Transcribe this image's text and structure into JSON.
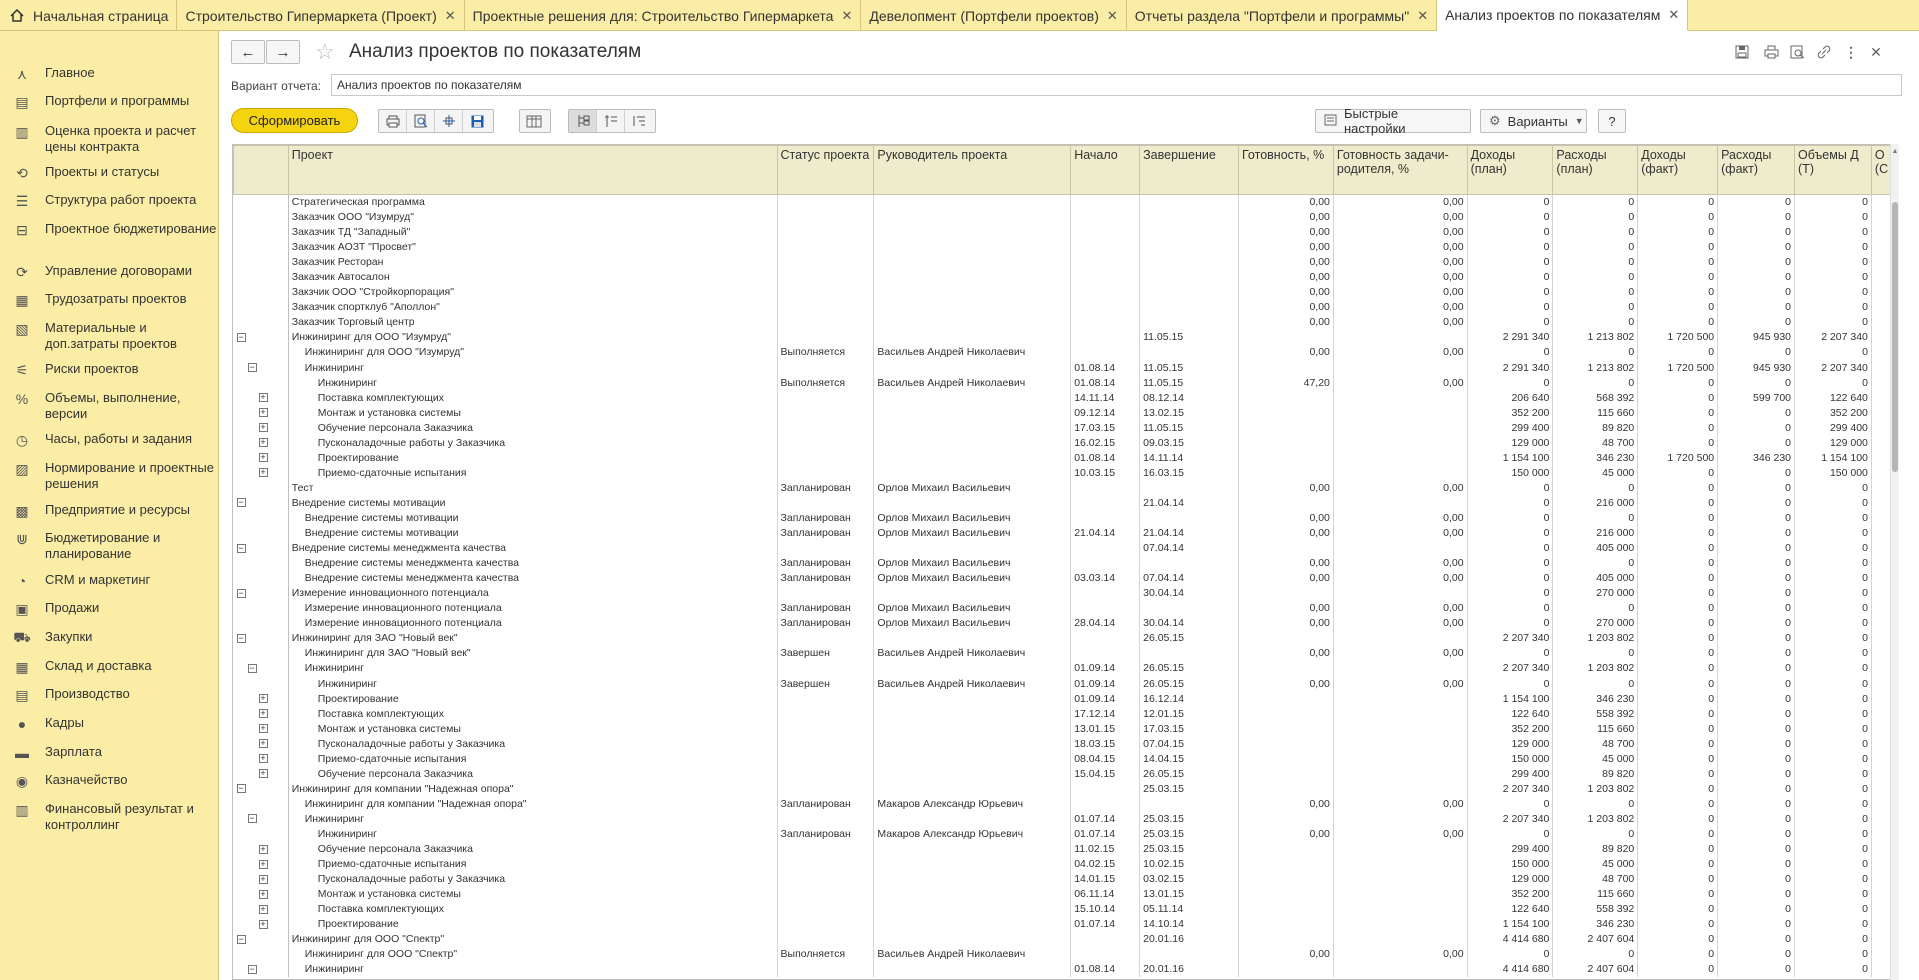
{
  "tabs": [
    {
      "label": "Начальная страница",
      "home": true
    },
    {
      "label": "Строительство Гипермаркета (Проект)",
      "close": "✕"
    },
    {
      "label": "Проектные решения для: Строительство Гипермаркета",
      "close": "✕"
    },
    {
      "label": "Девелопмент (Портфели проектов)",
      "close": "✕"
    },
    {
      "label": "Отчеты раздела \"Портфели и программы\"",
      "close": "✕"
    },
    {
      "label": "Анализ проектов по показателям",
      "close": "✕",
      "active": true
    }
  ],
  "sidebar": [
    {
      "label": "Главное",
      "icon": "menu-icon"
    },
    {
      "label": "Портфели и программы",
      "icon": "portfolio-icon"
    },
    {
      "label": "Оценка проекта и расчет цены контракта",
      "icon": "estimate-icon"
    },
    {
      "label": "Проекты и статусы",
      "icon": "projects-icon"
    },
    {
      "label": "Структура работ проекта",
      "icon": "structure-icon"
    },
    {
      "label": "Проектное бюджетирование",
      "icon": "budget-icon"
    },
    {
      "label": "Управление договорами",
      "icon": "contract-icon"
    },
    {
      "label": "Трудозатраты проектов",
      "icon": "labor-icon"
    },
    {
      "label": "Материальные и доп.затраты проектов",
      "icon": "materials-icon"
    },
    {
      "label": "Риски проектов",
      "icon": "risk-icon"
    },
    {
      "label": "Объемы, выполнение, версии",
      "icon": "volume-icon"
    },
    {
      "label": "Часы, работы и задания",
      "icon": "hours-icon"
    },
    {
      "label": "Нормирование и проектные решения",
      "icon": "norm-icon"
    },
    {
      "label": "Предприятие и ресурсы",
      "icon": "enterprise-icon"
    },
    {
      "label": "Бюджетирование и планирование",
      "icon": "planning-icon"
    },
    {
      "label": "CRM и маркетинг",
      "icon": "crm-icon"
    },
    {
      "label": "Продажи",
      "icon": "sales-icon"
    },
    {
      "label": "Закупки",
      "icon": "purchase-icon"
    },
    {
      "label": "Склад и доставка",
      "icon": "warehouse-icon"
    },
    {
      "label": "Производство",
      "icon": "production-icon"
    },
    {
      "label": "Кадры",
      "icon": "staff-icon"
    },
    {
      "label": "Зарплата",
      "icon": "salary-icon"
    },
    {
      "label": "Казначейство",
      "icon": "treasury-icon"
    },
    {
      "label": "Финансовый результат и контроллинг",
      "icon": "finance-icon"
    }
  ],
  "header": {
    "title": "Анализ проектов по показателям",
    "back": "←",
    "forward": "→",
    "star": "☆"
  },
  "variant": {
    "label": "Вариант отчета:",
    "value": "Анализ проектов по показателям"
  },
  "toolbar": {
    "run_label": "Сформировать",
    "quick_settings_label": "Быстрые настройки",
    "variants_label": "Варианты",
    "help_label": "?"
  },
  "columns": [
    "Проект",
    "Статус проекта",
    "Руководитель проекта",
    "Начало",
    "Завершение",
    "Готовность, %",
    "Готовность задачи-родителя, %",
    "Доходы (план)",
    "Расходы (план)",
    "Доходы (факт)",
    "Расходы (факт)",
    "Объемы Д (Т)",
    "О (С"
  ],
  "rows": [
    {
      "lvl": 0,
      "t": "",
      "name": "Стратегическая программа",
      "st": "",
      "mgr": "",
      "s": "",
      "e": "",
      "r": "0,00",
      "rp": "0,00",
      "di": "0",
      "rpl": "0",
      "df": "0",
      "rf": "0",
      "v": "0"
    },
    {
      "lvl": 0,
      "t": "",
      "name": "Заказчик ООО \"Изумруд\"",
      "st": "",
      "mgr": "",
      "s": "",
      "e": "",
      "r": "0,00",
      "rp": "0,00",
      "di": "0",
      "rpl": "0",
      "df": "0",
      "rf": "0",
      "v": "0"
    },
    {
      "lvl": 0,
      "t": "",
      "name": "Заказчик ТД \"Западный\"",
      "st": "",
      "mgr": "",
      "s": "",
      "e": "",
      "r": "0,00",
      "rp": "0,00",
      "di": "0",
      "rpl": "0",
      "df": "0",
      "rf": "0",
      "v": "0"
    },
    {
      "lvl": 0,
      "t": "",
      "name": "Заказчик АОЗТ \"Просвет\"",
      "st": "",
      "mgr": "",
      "s": "",
      "e": "",
      "r": "0,00",
      "rp": "0,00",
      "di": "0",
      "rpl": "0",
      "df": "0",
      "rf": "0",
      "v": "0"
    },
    {
      "lvl": 0,
      "t": "",
      "name": "Заказчик Ресторан",
      "st": "",
      "mgr": "",
      "s": "",
      "e": "",
      "r": "0,00",
      "rp": "0,00",
      "di": "0",
      "rpl": "0",
      "df": "0",
      "rf": "0",
      "v": "0"
    },
    {
      "lvl": 0,
      "t": "",
      "name": "Заказчик Автосалон",
      "st": "",
      "mgr": "",
      "s": "",
      "e": "",
      "r": "0,00",
      "rp": "0,00",
      "di": "0",
      "rpl": "0",
      "df": "0",
      "rf": "0",
      "v": "0"
    },
    {
      "lvl": 0,
      "t": "",
      "name": "Закзчик ООО \"Стройкорпорация\"",
      "st": "",
      "mgr": "",
      "s": "",
      "e": "",
      "r": "0,00",
      "rp": "0,00",
      "di": "0",
      "rpl": "0",
      "df": "0",
      "rf": "0",
      "v": "0"
    },
    {
      "lvl": 0,
      "t": "",
      "name": "Заказчик спортклуб \"Аполлон\"",
      "st": "",
      "mgr": "",
      "s": "",
      "e": "",
      "r": "0,00",
      "rp": "0,00",
      "di": "0",
      "rpl": "0",
      "df": "0",
      "rf": "0",
      "v": "0"
    },
    {
      "lvl": 0,
      "t": "",
      "name": "Заказчик Торговый центр",
      "st": "",
      "mgr": "",
      "s": "",
      "e": "",
      "r": "0,00",
      "rp": "0,00",
      "di": "0",
      "rpl": "0",
      "df": "0",
      "rf": "0",
      "v": "0"
    },
    {
      "lvl": 0,
      "t": "−",
      "name": "Инжиниринг для ООО \"Изумруд\"",
      "st": "",
      "mgr": "",
      "s": "",
      "e": "11.05.15",
      "r": "",
      "rp": "",
      "di": "2 291 340",
      "rpl": "1 213 802",
      "df": "1 720 500",
      "rf": "945 930",
      "v": "2 207 340"
    },
    {
      "lvl": 1,
      "t": "",
      "name": "Инжиниринг для ООО \"Изумруд\"",
      "st": "Выполняется",
      "mgr": "Васильев Андрей Николаевич",
      "s": "",
      "e": "",
      "r": "0,00",
      "rp": "0,00",
      "di": "0",
      "rpl": "0",
      "df": "0",
      "rf": "0",
      "v": "0"
    },
    {
      "lvl": 1,
      "t": "−",
      "name": "Инжиниринг",
      "st": "",
      "mgr": "",
      "s": "01.08.14",
      "e": "11.05.15",
      "r": "",
      "rp": "",
      "di": "2 291 340",
      "rpl": "1 213 802",
      "df": "1 720 500",
      "rf": "945 930",
      "v": "2 207 340"
    },
    {
      "lvl": 2,
      "t": "",
      "name": "Инжиниринг",
      "st": "Выполняется",
      "mgr": "Васильев Андрей Николаевич",
      "s": "01.08.14",
      "e": "11.05.15",
      "r": "47,20",
      "rp": "0,00",
      "di": "0",
      "rpl": "0",
      "df": "0",
      "rf": "0",
      "v": "0"
    },
    {
      "lvl": 2,
      "t": "+",
      "name": "Поставка комплектующих",
      "st": "",
      "mgr": "",
      "s": "14.11.14",
      "e": "08.12.14",
      "r": "",
      "rp": "",
      "di": "206 640",
      "rpl": "568 392",
      "df": "0",
      "rf": "599 700",
      "v": "122 640"
    },
    {
      "lvl": 2,
      "t": "+",
      "name": "Монтаж и установка системы",
      "st": "",
      "mgr": "",
      "s": "09.12.14",
      "e": "13.02.15",
      "r": "",
      "rp": "",
      "di": "352 200",
      "rpl": "115 660",
      "df": "0",
      "rf": "0",
      "v": "352 200"
    },
    {
      "lvl": 2,
      "t": "+",
      "name": "Обучение персонала Заказчика",
      "st": "",
      "mgr": "",
      "s": "17.03.15",
      "e": "11.05.15",
      "r": "",
      "rp": "",
      "di": "299 400",
      "rpl": "89 820",
      "df": "0",
      "rf": "0",
      "v": "299 400"
    },
    {
      "lvl": 2,
      "t": "+",
      "name": "Пусконаладочные работы у Заказчика",
      "st": "",
      "mgr": "",
      "s": "16.02.15",
      "e": "09.03.15",
      "r": "",
      "rp": "",
      "di": "129 000",
      "rpl": "48 700",
      "df": "0",
      "rf": "0",
      "v": "129 000"
    },
    {
      "lvl": 2,
      "t": "+",
      "name": "Проектирование",
      "st": "",
      "mgr": "",
      "s": "01.08.14",
      "e": "14.11.14",
      "r": "",
      "rp": "",
      "di": "1 154 100",
      "rpl": "346 230",
      "df": "1 720 500",
      "rf": "346 230",
      "v": "1 154 100"
    },
    {
      "lvl": 2,
      "t": "+",
      "name": "Приемо-сдаточные испытания",
      "st": "",
      "mgr": "",
      "s": "10.03.15",
      "e": "16.03.15",
      "r": "",
      "rp": "",
      "di": "150 000",
      "rpl": "45 000",
      "df": "0",
      "rf": "0",
      "v": "150 000"
    },
    {
      "lvl": 0,
      "t": "",
      "name": "Тест",
      "st": "Запланирован",
      "mgr": "Орлов Михаил Васильевич",
      "s": "",
      "e": "",
      "r": "0,00",
      "rp": "0,00",
      "di": "0",
      "rpl": "0",
      "df": "0",
      "rf": "0",
      "v": "0"
    },
    {
      "lvl": 0,
      "t": "−",
      "name": "Внедрение системы мотивации",
      "st": "",
      "mgr": "",
      "s": "",
      "e": "21.04.14",
      "r": "",
      "rp": "",
      "di": "0",
      "rpl": "216 000",
      "df": "0",
      "rf": "0",
      "v": "0"
    },
    {
      "lvl": 1,
      "t": "",
      "name": "Внедрение системы мотивации",
      "st": "Запланирован",
      "mgr": "Орлов Михаил Васильевич",
      "s": "",
      "e": "",
      "r": "0,00",
      "rp": "0,00",
      "di": "0",
      "rpl": "0",
      "df": "0",
      "rf": "0",
      "v": "0"
    },
    {
      "lvl": 1,
      "t": "",
      "name": "Внедрение системы мотивации",
      "st": "Запланирован",
      "mgr": "Орлов Михаил Васильевич",
      "s": "21.04.14",
      "e": "21.04.14",
      "r": "0,00",
      "rp": "0,00",
      "di": "0",
      "rpl": "216 000",
      "df": "0",
      "rf": "0",
      "v": "0"
    },
    {
      "lvl": 0,
      "t": "−",
      "name": "Внедрение системы менеджмента качества",
      "st": "",
      "mgr": "",
      "s": "",
      "e": "07.04.14",
      "r": "",
      "rp": "",
      "di": "0",
      "rpl": "405 000",
      "df": "0",
      "rf": "0",
      "v": "0"
    },
    {
      "lvl": 1,
      "t": "",
      "name": "Внедрение системы менеджмента качества",
      "st": "Запланирован",
      "mgr": "Орлов Михаил Васильевич",
      "s": "",
      "e": "",
      "r": "0,00",
      "rp": "0,00",
      "di": "0",
      "rpl": "0",
      "df": "0",
      "rf": "0",
      "v": "0"
    },
    {
      "lvl": 1,
      "t": "",
      "name": "Внедрение системы менеджмента качества",
      "st": "Запланирован",
      "mgr": "Орлов Михаил Васильевич",
      "s": "03.03.14",
      "e": "07.04.14",
      "r": "0,00",
      "rp": "0,00",
      "di": "0",
      "rpl": "405 000",
      "df": "0",
      "rf": "0",
      "v": "0"
    },
    {
      "lvl": 0,
      "t": "−",
      "name": "Измерение инновационного потенциала",
      "st": "",
      "mgr": "",
      "s": "",
      "e": "30.04.14",
      "r": "",
      "rp": "",
      "di": "0",
      "rpl": "270 000",
      "df": "0",
      "rf": "0",
      "v": "0"
    },
    {
      "lvl": 1,
      "t": "",
      "name": "Измерение инновационного потенциала",
      "st": "Запланирован",
      "mgr": "Орлов Михаил Васильевич",
      "s": "",
      "e": "",
      "r": "0,00",
      "rp": "0,00",
      "di": "0",
      "rpl": "0",
      "df": "0",
      "rf": "0",
      "v": "0"
    },
    {
      "lvl": 1,
      "t": "",
      "name": "Измерение инновационного потенциала",
      "st": "Запланирован",
      "mgr": "Орлов Михаил Васильевич",
      "s": "28.04.14",
      "e": "30.04.14",
      "r": "0,00",
      "rp": "0,00",
      "di": "0",
      "rpl": "270 000",
      "df": "0",
      "rf": "0",
      "v": "0"
    },
    {
      "lvl": 0,
      "t": "−",
      "name": "Инжиниринг для ЗАО \"Новый век\"",
      "st": "",
      "mgr": "",
      "s": "",
      "e": "26.05.15",
      "r": "",
      "rp": "",
      "di": "2 207 340",
      "rpl": "1 203 802",
      "df": "0",
      "rf": "0",
      "v": "0"
    },
    {
      "lvl": 1,
      "t": "",
      "name": "Инжиниринг для ЗАО \"Новый век\"",
      "st": "Завершен",
      "mgr": "Васильев Андрей Николаевич",
      "s": "",
      "e": "",
      "r": "0,00",
      "rp": "0,00",
      "di": "0",
      "rpl": "0",
      "df": "0",
      "rf": "0",
      "v": "0"
    },
    {
      "lvl": 1,
      "t": "−",
      "name": "Инжиниринг",
      "st": "",
      "mgr": "",
      "s": "01.09.14",
      "e": "26.05.15",
      "r": "",
      "rp": "",
      "di": "2 207 340",
      "rpl": "1 203 802",
      "df": "0",
      "rf": "0",
      "v": "0"
    },
    {
      "lvl": 2,
      "t": "",
      "name": "Инжиниринг",
      "st": "Завершен",
      "mgr": "Васильев Андрей Николаевич",
      "s": "01.09.14",
      "e": "26.05.15",
      "r": "0,00",
      "rp": "0,00",
      "di": "0",
      "rpl": "0",
      "df": "0",
      "rf": "0",
      "v": "0"
    },
    {
      "lvl": 2,
      "t": "+",
      "name": "Проектирование",
      "st": "",
      "mgr": "",
      "s": "01.09.14",
      "e": "16.12.14",
      "r": "",
      "rp": "",
      "di": "1 154 100",
      "rpl": "346 230",
      "df": "0",
      "rf": "0",
      "v": "0"
    },
    {
      "lvl": 2,
      "t": "+",
      "name": "Поставка комплектующих",
      "st": "",
      "mgr": "",
      "s": "17.12.14",
      "e": "12.01.15",
      "r": "",
      "rp": "",
      "di": "122 640",
      "rpl": "558 392",
      "df": "0",
      "rf": "0",
      "v": "0"
    },
    {
      "lvl": 2,
      "t": "+",
      "name": "Монтаж и установка системы",
      "st": "",
      "mgr": "",
      "s": "13.01.15",
      "e": "17.03.15",
      "r": "",
      "rp": "",
      "di": "352 200",
      "rpl": "115 660",
      "df": "0",
      "rf": "0",
      "v": "0"
    },
    {
      "lvl": 2,
      "t": "+",
      "name": "Пусконаладочные работы у Заказчика",
      "st": "",
      "mgr": "",
      "s": "18.03.15",
      "e": "07.04.15",
      "r": "",
      "rp": "",
      "di": "129 000",
      "rpl": "48 700",
      "df": "0",
      "rf": "0",
      "v": "0"
    },
    {
      "lvl": 2,
      "t": "+",
      "name": "Приемо-сдаточные испытания",
      "st": "",
      "mgr": "",
      "s": "08.04.15",
      "e": "14.04.15",
      "r": "",
      "rp": "",
      "di": "150 000",
      "rpl": "45 000",
      "df": "0",
      "rf": "0",
      "v": "0"
    },
    {
      "lvl": 2,
      "t": "+",
      "name": "Обучение персонала Заказчика",
      "st": "",
      "mgr": "",
      "s": "15.04.15",
      "e": "26.05.15",
      "r": "",
      "rp": "",
      "di": "299 400",
      "rpl": "89 820",
      "df": "0",
      "rf": "0",
      "v": "0"
    },
    {
      "lvl": 0,
      "t": "−",
      "name": "Инжиниринг для компании \"Надежная опора\"",
      "st": "",
      "mgr": "",
      "s": "",
      "e": "25.03.15",
      "r": "",
      "rp": "",
      "di": "2 207 340",
      "rpl": "1 203 802",
      "df": "0",
      "rf": "0",
      "v": "0"
    },
    {
      "lvl": 1,
      "t": "",
      "name": "Инжиниринг для компании \"Надежная опора\"",
      "st": "Запланирован",
      "mgr": "Макаров Александр Юрьевич",
      "s": "",
      "e": "",
      "r": "0,00",
      "rp": "0,00",
      "di": "0",
      "rpl": "0",
      "df": "0",
      "rf": "0",
      "v": "0"
    },
    {
      "lvl": 1,
      "t": "−",
      "name": "Инжиниринг",
      "st": "",
      "mgr": "",
      "s": "01.07.14",
      "e": "25.03.15",
      "r": "",
      "rp": "",
      "di": "2 207 340",
      "rpl": "1 203 802",
      "df": "0",
      "rf": "0",
      "v": "0"
    },
    {
      "lvl": 2,
      "t": "",
      "name": "Инжиниринг",
      "st": "Запланирован",
      "mgr": "Макаров Александр Юрьевич",
      "s": "01.07.14",
      "e": "25.03.15",
      "r": "0,00",
      "rp": "0,00",
      "di": "0",
      "rpl": "0",
      "df": "0",
      "rf": "0",
      "v": "0"
    },
    {
      "lvl": 2,
      "t": "+",
      "name": "Обучение персонала Заказчика",
      "st": "",
      "mgr": "",
      "s": "11.02.15",
      "e": "25.03.15",
      "r": "",
      "rp": "",
      "di": "299 400",
      "rpl": "89 820",
      "df": "0",
      "rf": "0",
      "v": "0"
    },
    {
      "lvl": 2,
      "t": "+",
      "name": "Приемо-сдаточные испытания",
      "st": "",
      "mgr": "",
      "s": "04.02.15",
      "e": "10.02.15",
      "r": "",
      "rp": "",
      "di": "150 000",
      "rpl": "45 000",
      "df": "0",
      "rf": "0",
      "v": "0"
    },
    {
      "lvl": 2,
      "t": "+",
      "name": "Пусконаладочные работы у Заказчика",
      "st": "",
      "mgr": "",
      "s": "14.01.15",
      "e": "03.02.15",
      "r": "",
      "rp": "",
      "di": "129 000",
      "rpl": "48 700",
      "df": "0",
      "rf": "0",
      "v": "0"
    },
    {
      "lvl": 2,
      "t": "+",
      "name": "Монтаж и установка системы",
      "st": "",
      "mgr": "",
      "s": "06.11.14",
      "e": "13.01.15",
      "r": "",
      "rp": "",
      "di": "352 200",
      "rpl": "115 660",
      "df": "0",
      "rf": "0",
      "v": "0"
    },
    {
      "lvl": 2,
      "t": "+",
      "name": "Поставка комплектующих",
      "st": "",
      "mgr": "",
      "s": "15.10.14",
      "e": "05.11.14",
      "r": "",
      "rp": "",
      "di": "122 640",
      "rpl": "558 392",
      "df": "0",
      "rf": "0",
      "v": "0"
    },
    {
      "lvl": 2,
      "t": "+",
      "name": "Проектирование",
      "st": "",
      "mgr": "",
      "s": "01.07.14",
      "e": "14.10.14",
      "r": "",
      "rp": "",
      "di": "1 154 100",
      "rpl": "346 230",
      "df": "0",
      "rf": "0",
      "v": "0"
    },
    {
      "lvl": 0,
      "t": "−",
      "name": "Инжиниринг для ООО \"Спектр\"",
      "st": "",
      "mgr": "",
      "s": "",
      "e": "20.01.16",
      "r": "",
      "rp": "",
      "di": "4 414 680",
      "rpl": "2 407 604",
      "df": "0",
      "rf": "0",
      "v": "0"
    },
    {
      "lvl": 1,
      "t": "",
      "name": "Инжиниринг для ООО \"Спектр\"",
      "st": "Выполняется",
      "mgr": "Васильев Андрей Николаевич",
      "s": "",
      "e": "",
      "r": "0,00",
      "rp": "0,00",
      "di": "0",
      "rpl": "0",
      "df": "0",
      "rf": "0",
      "v": "0"
    },
    {
      "lvl": 1,
      "t": "−",
      "name": "Инжиниринг",
      "st": "",
      "mgr": "",
      "s": "01.08.14",
      "e": "20.01.16",
      "r": "",
      "rp": "",
      "di": "4 414 680",
      "rpl": "2 407 604",
      "df": "0",
      "rf": "0",
      "v": "0"
    }
  ]
}
